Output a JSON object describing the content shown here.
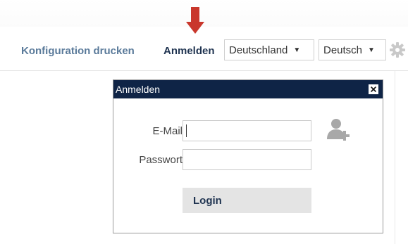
{
  "toolbar": {
    "print_config_label": "Konfiguration drucken",
    "login_link_label": "Anmelden",
    "country_select": {
      "value": "Deutschland"
    },
    "language_select": {
      "value": "Deutsch"
    },
    "settings_icon": "gear-icon",
    "highlight_arrow_color": "#c9372c"
  },
  "login_dialog": {
    "title": "Anmelden",
    "email_label": "E-Mail",
    "email_value": "",
    "password_label": "Passwort",
    "password_value": "",
    "login_button_label": "Login",
    "add_user_icon": "add-user-icon",
    "title_bar_color": "#0f2446"
  }
}
